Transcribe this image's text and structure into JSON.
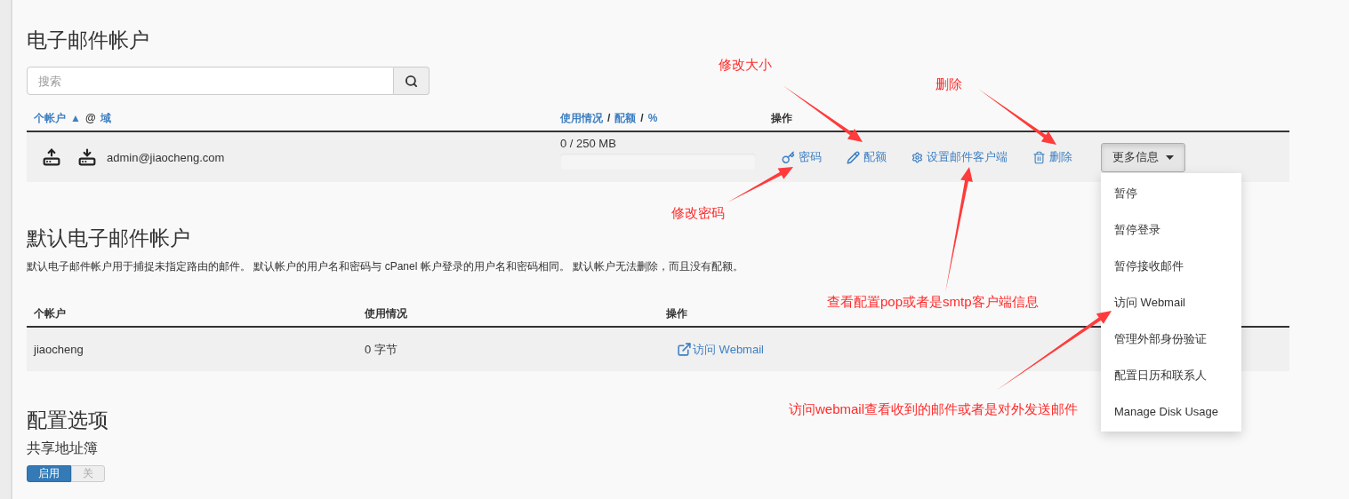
{
  "email_accounts": {
    "title": "电子邮件帐户",
    "search": {
      "placeholder": "搜索"
    },
    "columns": [
      {
        "parts": [
          {
            "kind": "link",
            "text": "个帐户"
          },
          {
            "kind": "sort",
            "text": "▲"
          },
          {
            "kind": "text",
            "text": "@"
          },
          {
            "kind": "link",
            "text": "域"
          }
        ]
      },
      {
        "parts": [
          {
            "kind": "link",
            "text": "使用情况"
          },
          {
            "kind": "text",
            "text": "/"
          },
          {
            "kind": "link",
            "text": "配额"
          },
          {
            "kind": "text",
            "text": "/"
          },
          {
            "kind": "link",
            "text": "%"
          }
        ]
      },
      {
        "parts": [
          {
            "kind": "text",
            "text": "操作"
          }
        ]
      }
    ],
    "rows": [
      {
        "email": "admin@jiaocheng.com",
        "usage": "0 / 250 MB",
        "level": 0,
        "actions": [
          {
            "kind": "password",
            "label": "密码"
          },
          {
            "kind": "quota",
            "label": "配额"
          },
          {
            "kind": "client",
            "label": "设置邮件客户端"
          },
          {
            "kind": "delete",
            "label": "删除"
          }
        ],
        "more": {
          "label": "更多信息",
          "expanded": true,
          "items": [
            "暂停",
            "暂停登录",
            "暂停接收邮件",
            "访问 Webmail",
            "管理外部身份验证",
            "配置日历和联系人",
            "Manage Disk Usage"
          ]
        }
      }
    ]
  },
  "default_account": {
    "title": "默认电子邮件帐户",
    "description": "默认电子邮件帐户用于捕捉未指定路由的邮件。 默认帐户的用户名和密码与 cPanel 帐户登录的用户名和密码相同。 默认帐户无法删除，而且没有配额。",
    "columns": [
      "个帐户",
      "使用情况",
      "操作"
    ],
    "rows": [
      {
        "account": "jiaocheng",
        "usage": "0 字节",
        "action": "访问 Webmail"
      }
    ]
  },
  "config": {
    "title": "配置选项",
    "subtitle": "共享地址簿",
    "toggle": [
      {
        "label": "启用",
        "selected": true
      },
      {
        "label": "关",
        "selected": false
      }
    ]
  },
  "annotations": [
    {
      "text": "修改大小"
    },
    {
      "text": "删除"
    },
    {
      "text": "修改密码"
    },
    {
      "text": "查看配置pop或者是smtp客户端信息"
    },
    {
      "text": "访问webmail查看收到的邮件或者是对外发送邮件"
    }
  ]
}
